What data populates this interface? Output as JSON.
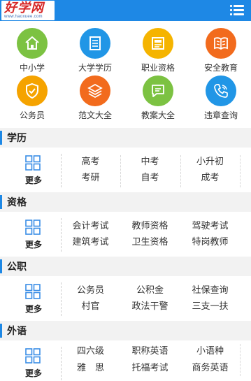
{
  "header": {
    "logo_text": "好学网",
    "logo_sub": "www.haoxuee.com",
    "menu_icon": "list-menu-icon"
  },
  "icon_grid": [
    {
      "label": "中小学",
      "icon": "home-icon",
      "color": "#7cc242"
    },
    {
      "label": "大学学历",
      "icon": "building-icon",
      "color": "#2196e6"
    },
    {
      "label": "职业资格",
      "icon": "certificate-icon",
      "color": "#f5b400"
    },
    {
      "label": "安全教育",
      "icon": "book-icon",
      "color": "#f26b1d"
    },
    {
      "label": "公务员",
      "icon": "shield-icon",
      "color": "#f5a300"
    },
    {
      "label": "范文大全",
      "icon": "layers-icon",
      "color": "#f26b1d"
    },
    {
      "label": "教案大全",
      "icon": "message-icon",
      "color": "#7cc242"
    },
    {
      "label": "违章查询",
      "icon": "phone-icon",
      "color": "#2196e6"
    }
  ],
  "sections": [
    {
      "title": "学历",
      "more_label": "更多",
      "rows": [
        [
          "高考",
          "中考",
          "小升初"
        ],
        [
          "考研",
          "自考",
          "成考"
        ]
      ]
    },
    {
      "title": "资格",
      "more_label": "更多",
      "rows": [
        [
          "会计考试",
          "教师资格",
          "驾驶考试"
        ],
        [
          "建筑考试",
          "卫生资格",
          "特岗教师"
        ]
      ]
    },
    {
      "title": "公职",
      "more_label": "更多",
      "rows": [
        [
          "公务员",
          "公积金",
          "社保查询"
        ],
        [
          "村官",
          "政法干警",
          "三支一扶"
        ]
      ]
    },
    {
      "title": "外语",
      "more_label": "更多",
      "rows": [
        [
          "四六级",
          "职称英语",
          "小语种"
        ],
        [
          "雅　思",
          "托福考试",
          "商务英语"
        ]
      ]
    }
  ],
  "colors": {
    "header_bg": "#1e88e5",
    "section_bar": "#1e88e5",
    "logo_red": "#d62828",
    "section_bg": "#f2f2f2"
  }
}
